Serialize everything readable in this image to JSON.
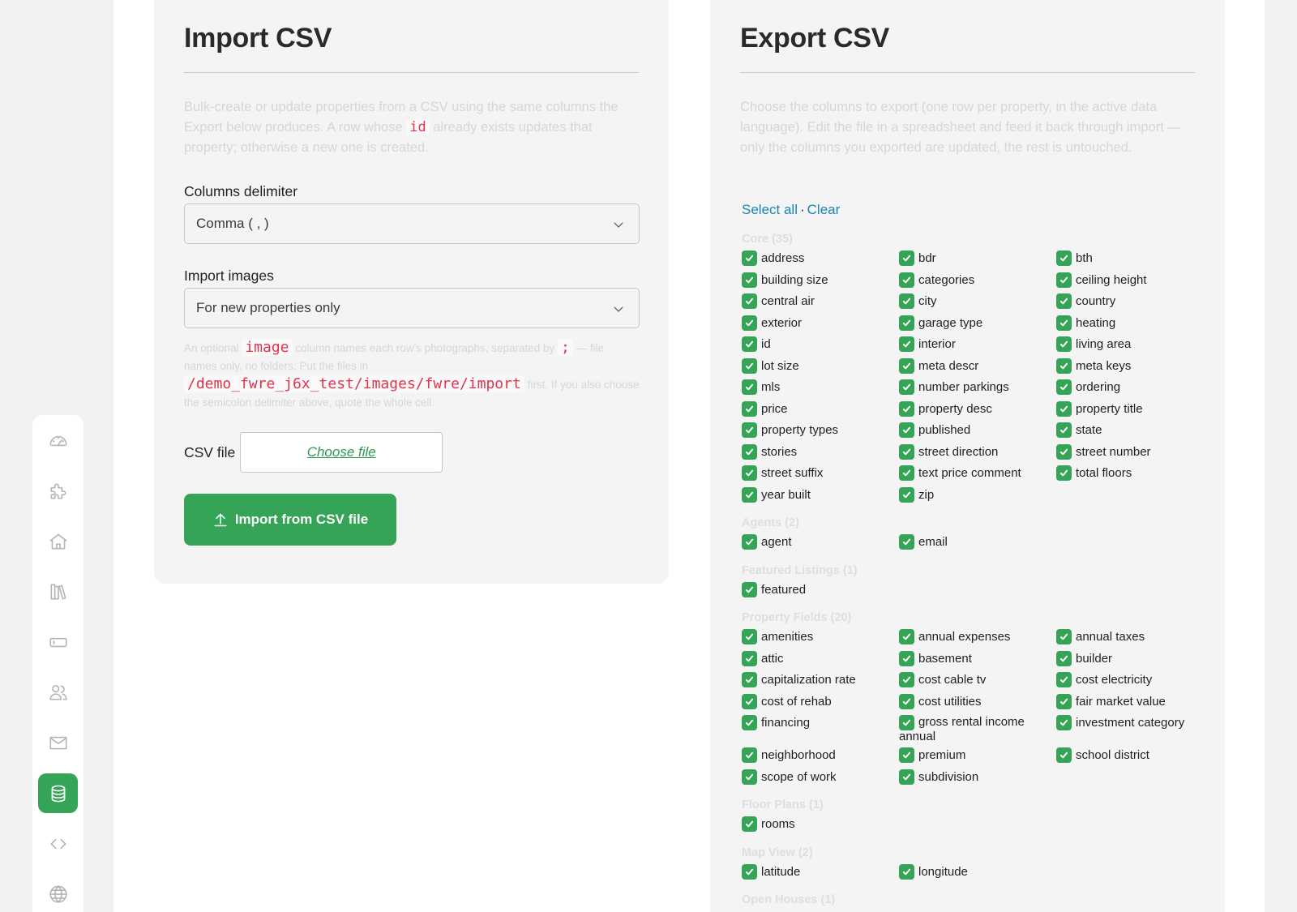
{
  "colors": {
    "accent": "#36a457",
    "link": "#1a85b5",
    "code": "#e0344e"
  },
  "sidebar": {
    "items": [
      {
        "name": "dashboard",
        "icon": "gauge-icon"
      },
      {
        "name": "extensions",
        "icon": "puzzle-icon"
      },
      {
        "name": "properties",
        "icon": "home-icon"
      },
      {
        "name": "catalog",
        "icon": "library-icon"
      },
      {
        "name": "banners",
        "icon": "rectangle-icon"
      },
      {
        "name": "agents",
        "icon": "users-icon"
      },
      {
        "name": "messages",
        "icon": "envelope-icon"
      },
      {
        "name": "import-export",
        "icon": "database-icon",
        "active": true
      },
      {
        "name": "embed",
        "icon": "code-icon"
      },
      {
        "name": "languages",
        "icon": "globe-icon"
      }
    ]
  },
  "import": {
    "title": "Import CSV",
    "desc_1": "Bulk-create or update properties from a CSV using the same columns the Export below produces. A row whose ",
    "desc_code": "id",
    "desc_2": " already exists updates that property; otherwise a new one is created.",
    "delimiter_label": "Columns delimiter",
    "delimiter_value": "Comma ( , )",
    "images_label": "Import images",
    "images_value": "For new properties only",
    "note_1": "An optional ",
    "note_code_1": "image",
    "note_2": " column names each row's photographs, separated by ",
    "note_code_2": ";",
    "note_3": " — file names only, no folders. Put the files in ",
    "note_code_3": "/demo_fwre_j6x_test/images/fwre/import",
    "note_4": " first. If you also choose the semicolon delimiter above, quote the whole cell.",
    "file_label": "CSV file",
    "file_button": "Choose file",
    "import_button": "Import from CSV file"
  },
  "export": {
    "title": "Export CSV",
    "desc": "Choose the columns to export (one row per property, in the active data language). Edit the file in a spreadsheet and feed it back through import — only the columns you exported are updated, the rest is untouched.",
    "select_all": "Select all",
    "separator": "·",
    "clear": "Clear",
    "groups": [
      {
        "title": "Core (35)",
        "items": [
          "address",
          "bdr",
          "bth",
          "building size",
          "categories",
          "ceiling height",
          "central air",
          "city",
          "country",
          "exterior",
          "garage type",
          "heating",
          "id",
          "interior",
          "living area",
          "lot size",
          "meta descr",
          "meta keys",
          "mls",
          "number parkings",
          "ordering",
          "price",
          "property desc",
          "property title",
          "property types",
          "published",
          "state",
          "stories",
          "street direction",
          "street number",
          "street suffix",
          "text price comment",
          "total floors",
          "year built",
          "zip"
        ]
      },
      {
        "title": "Agents (2)",
        "items": [
          "agent",
          "email"
        ]
      },
      {
        "title": "Featured Listings (1)",
        "items": [
          "featured"
        ]
      },
      {
        "title": "Property Fields (20)",
        "items": [
          "amenities",
          "annual expenses",
          "annual taxes",
          "attic",
          "basement",
          "builder",
          "capitalization rate",
          "cost cable tv",
          "cost electricity",
          "cost of rehab",
          "cost utilities",
          "fair market value",
          "financing",
          "gross rental income annual",
          "investment category",
          "neighborhood",
          "premium",
          "school district",
          "scope of work",
          "subdivision"
        ]
      },
      {
        "title": "Floor Plans (1)",
        "items": [
          "rooms"
        ]
      },
      {
        "title": "Map View (2)",
        "items": [
          "latitude",
          "longitude"
        ]
      },
      {
        "title": "Open Houses (1)",
        "items": []
      }
    ]
  }
}
